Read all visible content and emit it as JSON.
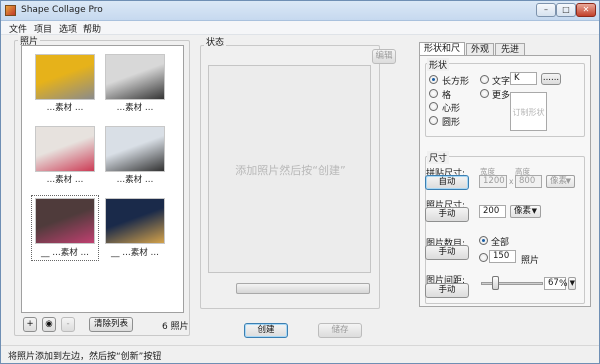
{
  "window": {
    "title": "Shape Collage Pro"
  },
  "menu": [
    "文件",
    "项目",
    "选项",
    "帮助"
  ],
  "photos": {
    "group_label": "照片",
    "items": [
      {
        "caption": "…素材 …",
        "colors": [
          "#e6b21a",
          "#8b8b8b"
        ]
      },
      {
        "caption": "…素材 …",
        "colors": [
          "#d8d8d8",
          "#343434"
        ]
      },
      {
        "caption": "…素材 …",
        "colors": [
          "#e7e2de",
          "#cc3b55"
        ]
      },
      {
        "caption": "…素材 …",
        "colors": [
          "#d9dfe6",
          "#313131"
        ]
      },
      {
        "caption": "__ …素材 …",
        "colors": [
          "#4f3b3b",
          "#c04070"
        ]
      },
      {
        "caption": "__ …素材 …",
        "colors": [
          "#1a2a4a",
          "#d4a24a"
        ]
      }
    ],
    "clear_button": "清除列表",
    "count_text": "6 照片",
    "add_icon_label": "+",
    "web_icon_label": "◉",
    "remove_icon_label": "-"
  },
  "status": {
    "group_label": "状态",
    "edit_button": "编辑",
    "hint": "添加照片然后按“创建”",
    "create_button": "创建",
    "save_button": "储存"
  },
  "tabs": [
    "形状和尺寸",
    "外观",
    "先进"
  ],
  "shape": {
    "group_label": "形状",
    "options": [
      "长方形",
      "格",
      "心形",
      "圆形"
    ],
    "selected": "长方形",
    "text_option": "文字",
    "text_value": "K",
    "more_option": "更多",
    "more_button": "......",
    "preview_label": "订制形状"
  },
  "size": {
    "group_label": "尺寸",
    "collage_size_label": "拼贴尺寸:",
    "collage_size_button": "自动",
    "width_label": "宽度",
    "height_label": "高度",
    "width_value": "1200",
    "height_value": "800",
    "x_sep": "x",
    "unit_value": "像素",
    "photo_size_label": "照片尺寸:",
    "photo_size_button": "手动",
    "photo_size_value": "200",
    "photo_size_unit": "像素",
    "photo_count_label": "图片数目:",
    "photo_count_button": "手动",
    "all_option": "全部",
    "count_value": "150",
    "count_unit": "照片",
    "spacing_label": "图片间距:",
    "spacing_button": "手动",
    "spacing_value": "67",
    "spacing_unit": "%",
    "spacing_level": 0.2
  },
  "statusbar": {
    "text": "将照片添加到左边，然后按“创新”按钮"
  }
}
